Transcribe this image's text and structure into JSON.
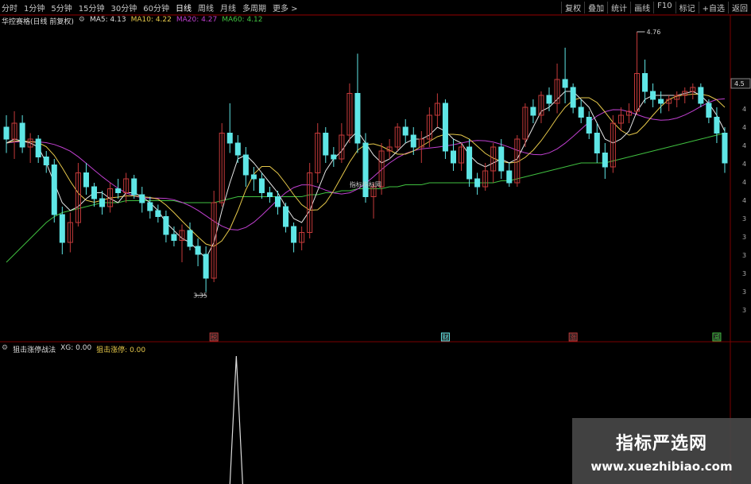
{
  "toolbar": {
    "left": [
      "分时",
      "1分钟",
      "5分钟",
      "15分钟",
      "30分钟",
      "60分钟",
      "日线",
      "周线",
      "月线",
      "多周期",
      "更多 >"
    ],
    "active_index": 6,
    "right": [
      "复权",
      "叠加",
      "统计",
      "画线",
      "F10",
      "标记",
      "+自选",
      "返回"
    ]
  },
  "legend": {
    "title": "华控赛格(日线 前复权)",
    "ma5": "MA5: 4.13",
    "ma10": "MA10: 4.22",
    "ma20": "MA20: 4.27",
    "ma60": "MA60: 4.12"
  },
  "sub_legend": {
    "title": "狙击涨停战法",
    "xg": "XG: 0.00",
    "jj": "狙击涨停: 0.00"
  },
  "annotations": {
    "high": "4.76",
    "low": "3.35",
    "last_price": "4.5",
    "chart_watermark": "指标指标网",
    "markers": [
      "税",
      "财",
      "涨",
      "减"
    ]
  },
  "watermark": {
    "line1": "指标严选网",
    "line2": "www.xuezhibiao.com"
  },
  "colors": {
    "up": "#c43a3a",
    "down": "#5fe6e6",
    "ma5": "#e6e6e6",
    "ma10": "#e6c84a",
    "ma20": "#c040d0",
    "ma60": "#40c040",
    "grid": "#7a0000"
  },
  "chart_data": {
    "type": "candlestick",
    "ylim": [
      3.3,
      4.8
    ],
    "y_ticks": [
      "4",
      "4",
      "4",
      "4",
      "4",
      "4",
      "3",
      "3",
      "3",
      "3",
      "3",
      "3"
    ],
    "candles": [
      [
        4.28,
        4.34,
        4.15,
        4.22
      ],
      [
        4.22,
        4.36,
        4.12,
        4.3
      ],
      [
        4.3,
        4.34,
        4.15,
        4.18
      ],
      [
        4.18,
        4.25,
        4.1,
        4.22
      ],
      [
        4.22,
        4.24,
        4.1,
        4.13
      ],
      [
        4.13,
        4.16,
        4.05,
        4.09
      ],
      [
        4.09,
        4.12,
        3.8,
        3.84
      ],
      [
        3.84,
        3.88,
        3.64,
        3.7
      ],
      [
        3.7,
        3.85,
        3.65,
        3.8
      ],
      [
        3.8,
        4.1,
        3.78,
        4.05
      ],
      [
        4.05,
        4.1,
        3.94,
        3.98
      ],
      [
        3.98,
        4.0,
        3.88,
        3.92
      ],
      [
        3.92,
        3.96,
        3.84,
        3.88
      ],
      [
        3.88,
        4.0,
        3.85,
        3.97
      ],
      [
        3.97,
        4.02,
        3.92,
        3.95
      ],
      [
        3.95,
        4.05,
        3.9,
        4.02
      ],
      [
        4.02,
        4.04,
        3.92,
        3.94
      ],
      [
        3.94,
        3.98,
        3.85,
        3.9
      ],
      [
        3.9,
        3.93,
        3.82,
        3.86
      ],
      [
        3.86,
        3.89,
        3.8,
        3.83
      ],
      [
        3.83,
        3.86,
        3.7,
        3.74
      ],
      [
        3.74,
        3.78,
        3.68,
        3.71
      ],
      [
        3.71,
        3.79,
        3.6,
        3.76
      ],
      [
        3.76,
        3.8,
        3.66,
        3.68
      ],
      [
        3.68,
        3.72,
        3.58,
        3.64
      ],
      [
        3.64,
        3.68,
        3.45,
        3.52
      ],
      [
        3.52,
        3.96,
        3.5,
        3.9
      ],
      [
        3.9,
        4.3,
        3.88,
        4.25
      ],
      [
        4.25,
        4.4,
        4.15,
        4.2
      ],
      [
        4.2,
        4.24,
        4.1,
        4.14
      ],
      [
        4.14,
        4.18,
        3.98,
        4.04
      ],
      [
        4.04,
        4.08,
        3.96,
        4.02
      ],
      [
        4.02,
        4.05,
        3.92,
        3.95
      ],
      [
        3.95,
        3.98,
        3.9,
        3.93
      ],
      [
        3.93,
        3.96,
        3.84,
        3.88
      ],
      [
        3.88,
        3.9,
        3.75,
        3.78
      ],
      [
        3.78,
        3.8,
        3.65,
        3.7
      ],
      [
        3.7,
        3.78,
        3.66,
        3.75
      ],
      [
        3.75,
        4.1,
        3.72,
        4.05
      ],
      [
        4.05,
        4.3,
        4.0,
        4.25
      ],
      [
        4.25,
        4.28,
        4.1,
        4.14
      ],
      [
        4.14,
        4.18,
        4.08,
        4.12
      ],
      [
        4.12,
        4.3,
        4.1,
        4.24
      ],
      [
        4.24,
        4.5,
        4.2,
        4.45
      ],
      [
        4.45,
        4.65,
        4.15,
        4.2
      ],
      [
        4.2,
        4.25,
        3.9,
        3.93
      ],
      [
        3.93,
        4.0,
        3.82,
        3.98
      ],
      [
        3.98,
        4.2,
        3.94,
        4.16
      ],
      [
        4.16,
        4.22,
        4.12,
        4.18
      ],
      [
        4.18,
        4.3,
        4.16,
        4.28
      ],
      [
        4.28,
        4.32,
        4.2,
        4.24
      ],
      [
        4.24,
        4.28,
        4.14,
        4.18
      ],
      [
        4.18,
        4.26,
        4.1,
        4.22
      ],
      [
        4.22,
        4.38,
        4.18,
        4.34
      ],
      [
        4.34,
        4.45,
        4.28,
        4.4
      ],
      [
        4.4,
        4.42,
        4.12,
        4.16
      ],
      [
        4.16,
        4.22,
        4.06,
        4.1
      ],
      [
        4.1,
        4.2,
        4.06,
        4.18
      ],
      [
        4.18,
        4.22,
        3.98,
        4.02
      ],
      [
        4.02,
        4.05,
        3.94,
        3.98
      ],
      [
        3.98,
        4.1,
        3.96,
        4.06
      ],
      [
        4.06,
        4.2,
        4.0,
        4.18
      ],
      [
        4.18,
        4.22,
        4.02,
        4.06
      ],
      [
        4.06,
        4.1,
        3.98,
        4.0
      ],
      [
        4.0,
        4.24,
        3.98,
        4.22
      ],
      [
        4.22,
        4.4,
        4.18,
        4.38
      ],
      [
        4.38,
        4.42,
        4.3,
        4.34
      ],
      [
        4.34,
        4.46,
        4.3,
        4.44
      ],
      [
        4.44,
        4.48,
        4.36,
        4.4
      ],
      [
        4.4,
        4.6,
        4.35,
        4.52
      ],
      [
        4.52,
        4.68,
        4.4,
        4.48
      ],
      [
        4.48,
        4.5,
        4.35,
        4.38
      ],
      [
        4.38,
        4.42,
        4.3,
        4.33
      ],
      [
        4.33,
        4.36,
        4.22,
        4.25
      ],
      [
        4.25,
        4.3,
        4.1,
        4.15
      ],
      [
        4.15,
        4.2,
        4.02,
        4.08
      ],
      [
        4.08,
        4.34,
        4.05,
        4.3
      ],
      [
        4.3,
        4.38,
        4.26,
        4.34
      ],
      [
        4.34,
        4.4,
        4.3,
        4.36
      ],
      [
        4.36,
        4.76,
        4.34,
        4.55
      ],
      [
        4.55,
        4.62,
        4.4,
        4.46
      ],
      [
        4.46,
        4.5,
        4.38,
        4.42
      ],
      [
        4.42,
        4.46,
        4.35,
        4.4
      ],
      [
        4.4,
        4.44,
        4.36,
        4.42
      ],
      [
        4.42,
        4.46,
        4.38,
        4.44
      ],
      [
        4.44,
        4.48,
        4.4,
        4.46
      ],
      [
        4.46,
        4.5,
        4.42,
        4.48
      ],
      [
        4.48,
        4.5,
        4.38,
        4.4
      ],
      [
        4.4,
        4.42,
        4.3,
        4.33
      ],
      [
        4.33,
        4.38,
        4.2,
        4.25
      ],
      [
        4.25,
        4.28,
        4.05,
        4.1
      ]
    ],
    "ma5": [
      4.2,
      4.22,
      4.21,
      4.2,
      4.18,
      4.1,
      4.0,
      3.9,
      3.86,
      3.88,
      3.92,
      3.95,
      3.95,
      3.92,
      3.9,
      3.95,
      3.95,
      3.93,
      3.9,
      3.86,
      3.8,
      3.76,
      3.72,
      3.7,
      3.66,
      3.62,
      3.7,
      3.86,
      4.0,
      4.12,
      4.14,
      4.1,
      4.05,
      4.0,
      3.95,
      3.88,
      3.82,
      3.8,
      3.86,
      3.96,
      4.06,
      4.12,
      4.16,
      4.22,
      4.26,
      4.2,
      4.14,
      4.1,
      4.12,
      4.16,
      4.2,
      4.22,
      4.22,
      4.24,
      4.28,
      4.26,
      4.22,
      4.2,
      4.14,
      4.1,
      4.08,
      4.1,
      4.12,
      4.1,
      4.12,
      4.2,
      4.28,
      4.36,
      4.38,
      4.42,
      4.46,
      4.46,
      4.42,
      4.38,
      4.3,
      4.22,
      4.2,
      4.22,
      4.26,
      4.36,
      4.42,
      4.44,
      4.44,
      4.44,
      4.44,
      4.45,
      4.46,
      4.44,
      4.4,
      4.34,
      4.26
    ],
    "ma60": [
      3.6,
      3.64,
      3.68,
      3.72,
      3.76,
      3.8,
      3.83,
      3.85,
      3.86,
      3.87,
      3.88,
      3.89,
      3.9,
      3.9,
      3.9,
      3.91,
      3.91,
      3.91,
      3.91,
      3.91,
      3.91,
      3.91,
      3.9,
      3.9,
      3.9,
      3.9,
      3.9,
      3.91,
      3.92,
      3.93,
      3.93,
      3.93,
      3.93,
      3.93,
      3.93,
      3.93,
      3.93,
      3.93,
      3.94,
      3.94,
      3.95,
      3.95,
      3.96,
      3.96,
      3.97,
      3.97,
      3.97,
      3.97,
      3.98,
      3.98,
      3.99,
      3.99,
      3.99,
      4.0,
      4.0,
      4.0,
      4.0,
      4.0,
      4.0,
      4.0,
      4.0,
      4.0,
      4.01,
      4.01,
      4.02,
      4.03,
      4.04,
      4.05,
      4.06,
      4.07,
      4.08,
      4.09,
      4.1,
      4.1,
      4.1,
      4.1,
      4.11,
      4.12,
      4.13,
      4.14,
      4.15,
      4.16,
      4.17,
      4.18,
      4.19,
      4.2,
      4.21,
      4.22,
      4.23,
      4.24,
      4.25
    ],
    "signal": {
      "index": 30,
      "value": 1.0
    }
  }
}
